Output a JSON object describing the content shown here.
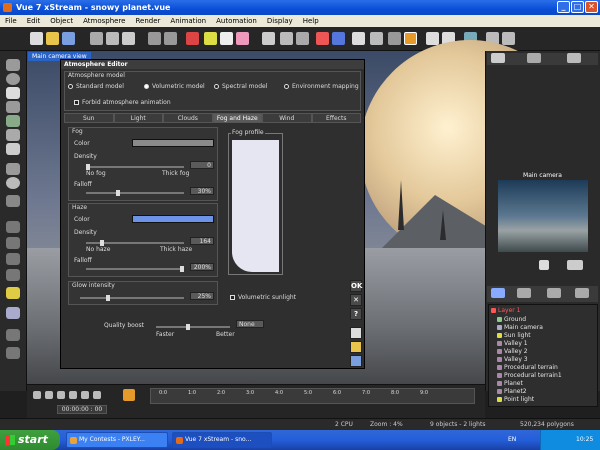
{
  "window": {
    "title": "Vue 7 xStream - snowy planet.vue",
    "min": "_",
    "max": "□",
    "close": "✕"
  },
  "menu": [
    "File",
    "Edit",
    "Object",
    "Atmosphere",
    "Render",
    "Animation",
    "Automation",
    "Display",
    "Help"
  ],
  "viewport": {
    "label": "Main camera view"
  },
  "dialog": {
    "title": "Atmosphere Editor",
    "model_group": "Atmosphere model",
    "models": [
      "Standard model",
      "Volumetric model",
      "Spectral model",
      "Environment mapping"
    ],
    "selected_model": "Volumetric model",
    "forbid_animation": "Forbid atmosphere animation",
    "tabs": [
      "Sun",
      "Light",
      "Clouds",
      "Fog and Haze",
      "Wind",
      "Effects"
    ],
    "active_tab": "Fog and Haze",
    "fog": {
      "title": "Fog",
      "color_label": "Color",
      "color": "#8a8a8a",
      "density_label": "Density",
      "density_value": "0",
      "density_min": "No fog",
      "density_max": "Thick fog",
      "falloff_label": "Falloff",
      "falloff_value": "30%"
    },
    "haze": {
      "title": "Haze",
      "color_label": "Color",
      "color": "#6e92e6",
      "density_label": "Density",
      "density_value": "164",
      "density_min": "No haze",
      "density_max": "Thick haze",
      "falloff_label": "Falloff",
      "falloff_value": "200%"
    },
    "fog_profile": "Fog profile",
    "glow_label": "Glow intensity",
    "glow_value": "25%",
    "volumetric_sunlight": "Volumetric sunlight",
    "quality_label": "Quality boost",
    "quality_value": "None",
    "quality_min": "Faster",
    "quality_max": "Better",
    "ok": "OK",
    "cancel": "✕",
    "help": "?"
  },
  "right": {
    "camera_header": "Main camera",
    "objects": [
      {
        "name": "Layer 1",
        "red": true
      },
      {
        "name": "Ground",
        "red": false
      },
      {
        "name": "Main camera",
        "red": false
      },
      {
        "name": "Sun light",
        "red": false
      },
      {
        "name": "Valley 1",
        "red": false
      },
      {
        "name": "Valley 2",
        "red": false
      },
      {
        "name": "Valley 3",
        "red": false
      },
      {
        "name": "Procedural terrain",
        "red": false
      },
      {
        "name": "Procedural terrain1",
        "red": false
      },
      {
        "name": "Planet",
        "red": false
      },
      {
        "name": "Planet2",
        "red": false
      },
      {
        "name": "Point light",
        "red": false
      }
    ]
  },
  "timeline": {
    "time": "00:00:00 : 00",
    "ticks": [
      "0:0",
      "1:0",
      "2:0",
      "3:0",
      "4:0",
      "5:0",
      "6:0",
      "7:0",
      "8:0",
      "9:0"
    ]
  },
  "status": {
    "cpu": "2 CPU",
    "zoom": "Zoom : 4%",
    "objects": "9 objects - 2 lights",
    "polygons": "520,234 polygons"
  },
  "taskbar": {
    "start": "start",
    "tasks": [
      "My Contests - PXLEY...",
      "Vue 7 xStream - sno..."
    ],
    "lang": "EN",
    "clock": "10:25"
  }
}
